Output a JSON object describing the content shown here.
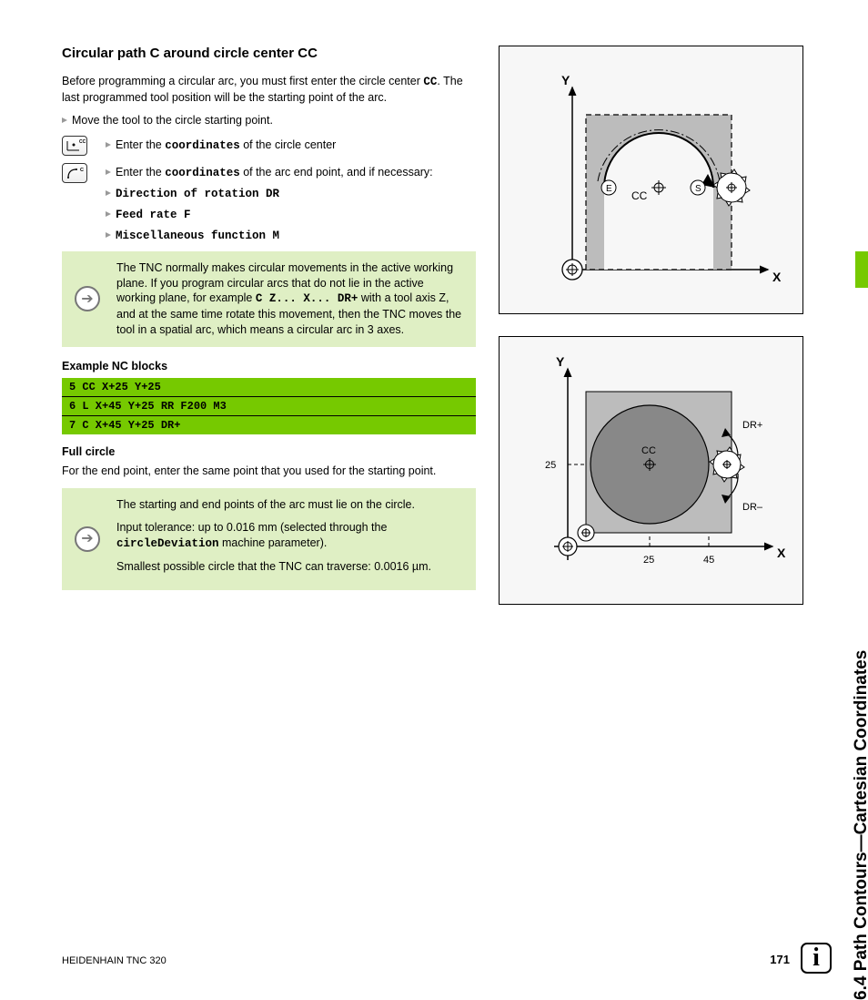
{
  "sideTab": "6.4 Path Contours—Cartesian Coordinates",
  "heading": "Circular path C around circle center CC",
  "intro": {
    "p1a": "Before programming a circular arc, you must first enter the circle center ",
    "p1b": ". The last programmed tool position will be the starting point of the arc.",
    "cc": "CC",
    "bullet1": "Move the tool to the circle starting point."
  },
  "keys": {
    "cc": "CC",
    "c": "C"
  },
  "steps": {
    "s1a": "Enter the ",
    "s1b": " of the circle center",
    "s2a": "Enter the ",
    "s2b": " of the arc end point, and if necessary:",
    "coords": "coordinates",
    "b1": "Direction of rotation DR",
    "b2": "Feed rate F",
    "b3": "Miscellaneous function M"
  },
  "note1": {
    "t1": "The TNC normally makes circular movements in the active working plane. If you program circular arcs that do not lie in the active working plane, for example ",
    "code": "C Z... X... DR+",
    "t2": " with a tool axis Z, and at the same time rotate this movement, then the TNC moves the tool in a spatial arc, which means a circular arc in 3 axes."
  },
  "exampleHead": "Example NC blocks",
  "code": {
    "l1": "5 CC X+25 Y+25",
    "l2": "6 L X+45 Y+25 RR F200 M3",
    "l3": "7 C X+45 Y+25 DR+"
  },
  "fullCircleHead": "Full circle",
  "fullCircleText": "For the end point, enter the same point that you used for the starting point.",
  "note2": {
    "t1": "The starting and end points of the arc must lie on the circle.",
    "t2a": "Input tolerance: up to 0.016 mm (selected through the ",
    "t2code": "circleDeviation",
    "t2b": " machine parameter).",
    "t3": "Smallest possible circle that the TNC can traverse: 0.0016 µm."
  },
  "diag1": {
    "Y": "Y",
    "X": "X",
    "CC": "CC",
    "E": "E",
    "S": "S"
  },
  "diag2": {
    "Y": "Y",
    "X": "X",
    "CC": "CC",
    "v25": "25",
    "v45": "45",
    "DRp": "DR+",
    "DRm": "DR–"
  },
  "footer": {
    "left": "HEIDENHAIN TNC 320",
    "page": "171"
  },
  "infoIcon": "i"
}
